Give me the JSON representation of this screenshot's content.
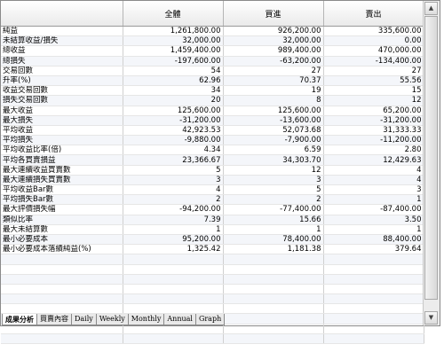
{
  "header": {
    "col_all": "全體",
    "col_buy": "買進",
    "col_sell": "賣出"
  },
  "rows": [
    {
      "label": "純益",
      "all": "1,261,800.00",
      "buy": "926,200.00",
      "sell": "335,600.00"
    },
    {
      "label": "未結算收益/損失",
      "all": "32,000.00",
      "buy": "32,000.00",
      "sell": "0.00"
    },
    {
      "label": "總收益",
      "all": "1,459,400.00",
      "buy": "989,400.00",
      "sell": "470,000.00"
    },
    {
      "label": "總損失",
      "all": "-197,600.00",
      "buy": "-63,200.00",
      "sell": "-134,400.00"
    },
    {
      "label": "交易回數",
      "all": "54",
      "buy": "27",
      "sell": "27"
    },
    {
      "label": "升率(%)",
      "all": "62.96",
      "buy": "70.37",
      "sell": "55.56"
    },
    {
      "label": "收益交易回數",
      "all": "34",
      "buy": "19",
      "sell": "15"
    },
    {
      "label": "損失交易回數",
      "all": "20",
      "buy": "8",
      "sell": "12"
    },
    {
      "label": "最大收益",
      "all": "125,600.00",
      "buy": "125,600.00",
      "sell": "65,200.00"
    },
    {
      "label": "最大損失",
      "all": "-31,200.00",
      "buy": "-13,600.00",
      "sell": "-31,200.00"
    },
    {
      "label": "平均收益",
      "all": "42,923.53",
      "buy": "52,073.68",
      "sell": "31,333.33"
    },
    {
      "label": "平均損失",
      "all": "-9,880.00",
      "buy": "-7,900.00",
      "sell": "-11,200.00"
    },
    {
      "label": "平均收益比率(倍)",
      "all": "4.34",
      "buy": "6.59",
      "sell": "2.80"
    },
    {
      "label": "平均各買賣損益",
      "all": "23,366.67",
      "buy": "34,303.70",
      "sell": "12,429.63"
    },
    {
      "label": "最大連續收益買賣數",
      "all": "5",
      "buy": "12",
      "sell": "4"
    },
    {
      "label": "最大連續損失買賣數",
      "all": "3",
      "buy": "3",
      "sell": "4"
    },
    {
      "label": "平均收益Bar數",
      "all": "4",
      "buy": "5",
      "sell": "3"
    },
    {
      "label": "平均損失Bar數",
      "all": "2",
      "buy": "2",
      "sell": "1"
    },
    {
      "label": "最大評價損失幅",
      "all": "-94,200.00",
      "buy": "-77,400.00",
      "sell": "-87,400.00"
    },
    {
      "label": "類似比率",
      "all": "7.39",
      "buy": "15.66",
      "sell": "3.50"
    },
    {
      "label": "最大未結算數",
      "all": "1",
      "buy": "1",
      "sell": "1"
    },
    {
      "label": "最小必要成本",
      "all": "95,200.00",
      "buy": "78,400.00",
      "sell": "88,400.00"
    },
    {
      "label": "最小必要成本落績純益(%)",
      "all": "1,325.42",
      "buy": "1,181.38",
      "sell": "379.64"
    }
  ],
  "tabs": [
    "成果分析",
    "買賣內容",
    "Daily",
    "Weekly",
    "Monthly",
    "Annual",
    "Graph"
  ],
  "active_tab": 0
}
